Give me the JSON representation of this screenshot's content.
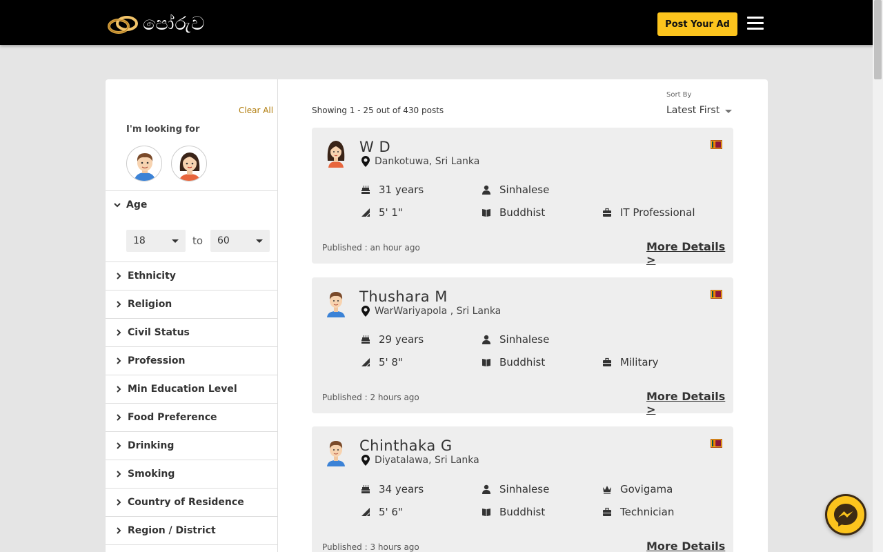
{
  "header": {
    "logo_text": "පෝරුව",
    "post_ad_label": "Post Your Ad"
  },
  "sidebar": {
    "clear_all": "Clear All",
    "looking_for": "I'm looking for",
    "age": {
      "label": "Age",
      "min": "18",
      "to": "to",
      "max": "60"
    },
    "filters": [
      {
        "label": "Ethnicity"
      },
      {
        "label": "Religion"
      },
      {
        "label": "Civil Status"
      },
      {
        "label": "Profession"
      },
      {
        "label": "Min Education Level"
      },
      {
        "label": "Food Preference"
      },
      {
        "label": "Drinking"
      },
      {
        "label": "Smoking"
      },
      {
        "label": "Country of Residence"
      },
      {
        "label": "Region / District"
      }
    ]
  },
  "listing": {
    "showing": "Showing 1 - 25 out of 430 posts",
    "sort_label": "Sort By",
    "sort_value": "Latest First",
    "more_details": "More Details >",
    "posts": [
      {
        "name": "W D",
        "gender": "female",
        "location": "Dankotuwa, Sri Lanka",
        "age": "31 years",
        "ethnicity": "Sinhalese",
        "caste": "",
        "height": "5' 1\"",
        "religion": "Buddhist",
        "profession": "IT Professional",
        "published": "Published : an hour ago"
      },
      {
        "name": "Thushara M",
        "gender": "male",
        "location": "WarWariyapola , Sri Lanka",
        "age": "29 years",
        "ethnicity": "Sinhalese",
        "caste": "",
        "height": "5' 8\"",
        "religion": "Buddhist",
        "profession": "Military",
        "published": "Published : 2 hours ago"
      },
      {
        "name": "Chinthaka G",
        "gender": "male",
        "location": "Diyatalawa, Sri Lanka",
        "age": "34 years",
        "ethnicity": "Sinhalese",
        "caste": "Govigama",
        "height": "5' 6\"",
        "religion": "Buddhist",
        "profession": "Technician",
        "published": "Published : 3 hours ago"
      }
    ]
  },
  "colors": {
    "accent": "#fcc41d",
    "header_bg": "#000000",
    "page_bg": "#e5e5e5",
    "card_bg": "#eeeeee"
  }
}
